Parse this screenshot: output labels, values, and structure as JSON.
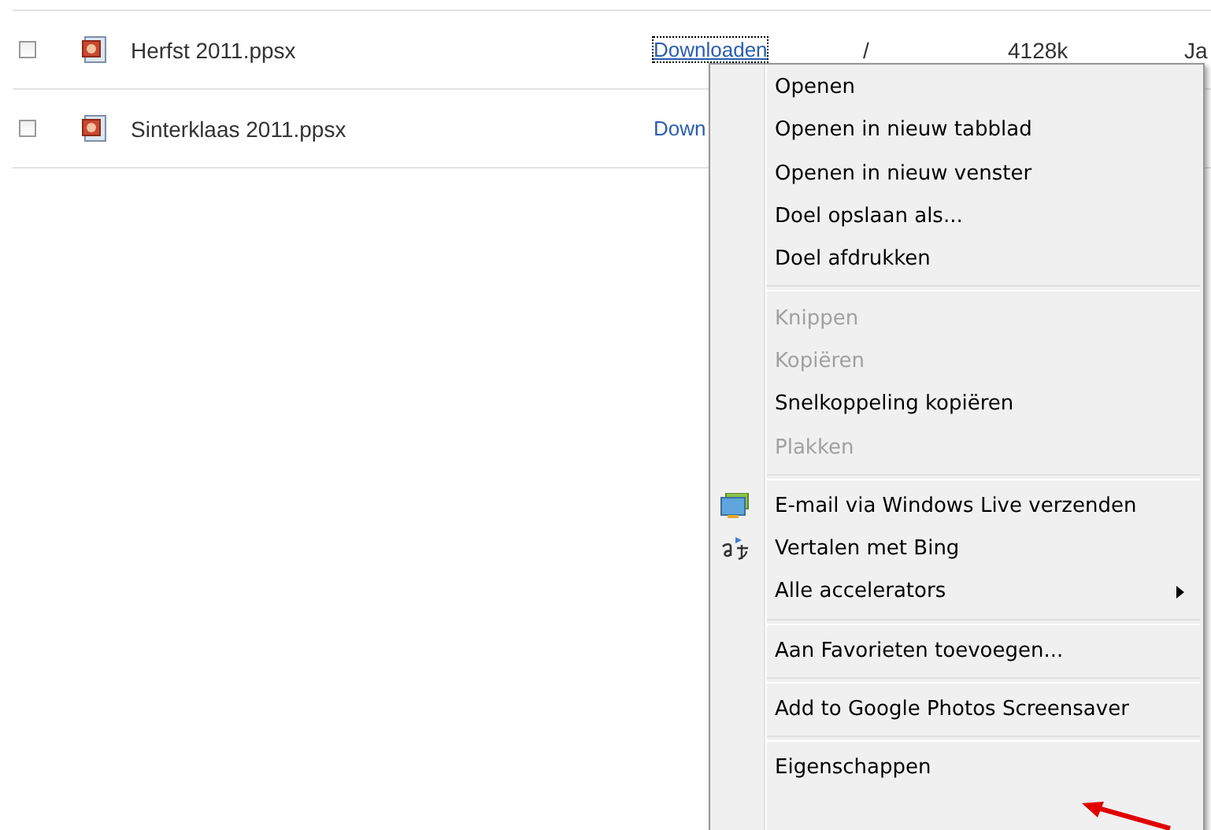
{
  "files": [
    {
      "checked": false,
      "name": "Herfst 2011.ppsx",
      "link": "Downloaden",
      "focused": true,
      "separator": "/",
      "size": "4128k",
      "date": "Ja"
    },
    {
      "checked": false,
      "name": "Sinterklaas 2011.ppsx",
      "link": "Down",
      "focused": false
    }
  ],
  "context_menu": {
    "items": [
      {
        "kind": "item",
        "label": "Openen",
        "disabled": false
      },
      {
        "kind": "item",
        "label": "Openen in nieuw tabblad",
        "disabled": false
      },
      {
        "kind": "item",
        "label": "Openen in nieuw venster",
        "disabled": false
      },
      {
        "kind": "item",
        "label": "Doel opslaan als...",
        "disabled": false
      },
      {
        "kind": "item",
        "label": "Doel afdrukken",
        "disabled": false
      },
      {
        "kind": "separator"
      },
      {
        "kind": "item",
        "label": "Knippen",
        "disabled": true
      },
      {
        "kind": "item",
        "label": "Kopiëren",
        "disabled": true
      },
      {
        "kind": "item",
        "label": "Snelkoppeling kopiëren",
        "disabled": false
      },
      {
        "kind": "item",
        "label": "Plakken",
        "disabled": true
      },
      {
        "kind": "separator"
      },
      {
        "kind": "mail",
        "label": "E-mail via Windows Live verzenden",
        "disabled": false
      },
      {
        "kind": "translate",
        "label": "Vertalen met Bing",
        "disabled": false
      },
      {
        "kind": "submenu",
        "label": "Alle accelerators",
        "disabled": false
      },
      {
        "kind": "separator"
      },
      {
        "kind": "item",
        "label": "Aan Favorieten toevoegen...",
        "disabled": false
      },
      {
        "kind": "separator"
      },
      {
        "kind": "item",
        "label": "Add to Google Photos Screensaver",
        "disabled": false
      },
      {
        "kind": "separator"
      },
      {
        "kind": "item",
        "label": "Eigenschappen",
        "disabled": false
      }
    ]
  }
}
